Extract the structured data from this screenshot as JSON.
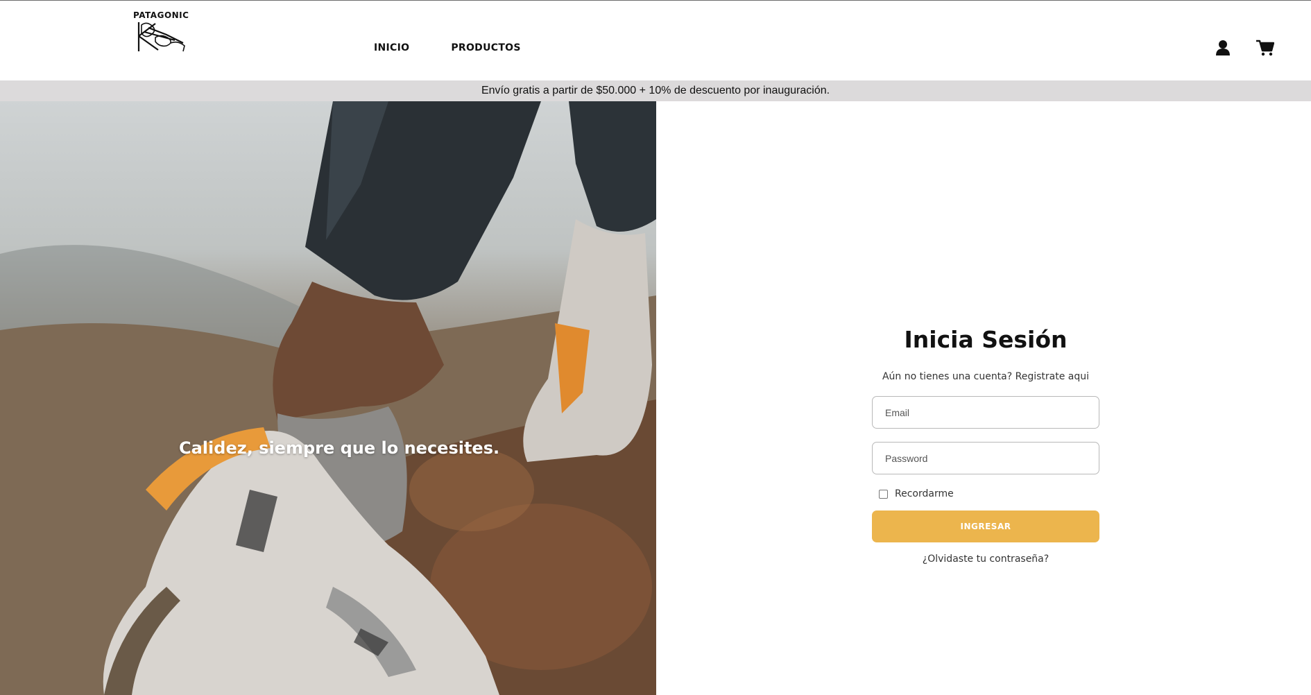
{
  "header": {
    "logo_text": "PATAGONIC",
    "nav": [
      {
        "label": "INICIO"
      },
      {
        "label": "PRODUCTOS"
      }
    ],
    "icons": [
      "user-icon",
      "cart-icon"
    ]
  },
  "promo": {
    "text": "Envío gratis a partir de $50.000 + 10% de descuento por inauguración."
  },
  "hero": {
    "caption": "Calidez, siempre que lo necesites."
  },
  "login": {
    "title": "Inicia Sesión",
    "register_prefix": "Aún no tienes una cuenta?",
    "register_link": "Registrate aqui",
    "email_placeholder": "Email",
    "password_placeholder": "Password",
    "remember_label": "Recordarme",
    "remember_checked": false,
    "submit_label": "INGRESAR",
    "forgot_label": "¿Olvidaste tu contraseña?"
  },
  "colors": {
    "accent": "#ecb54d",
    "promo_bg": "#dcdadb",
    "text": "#111111"
  }
}
